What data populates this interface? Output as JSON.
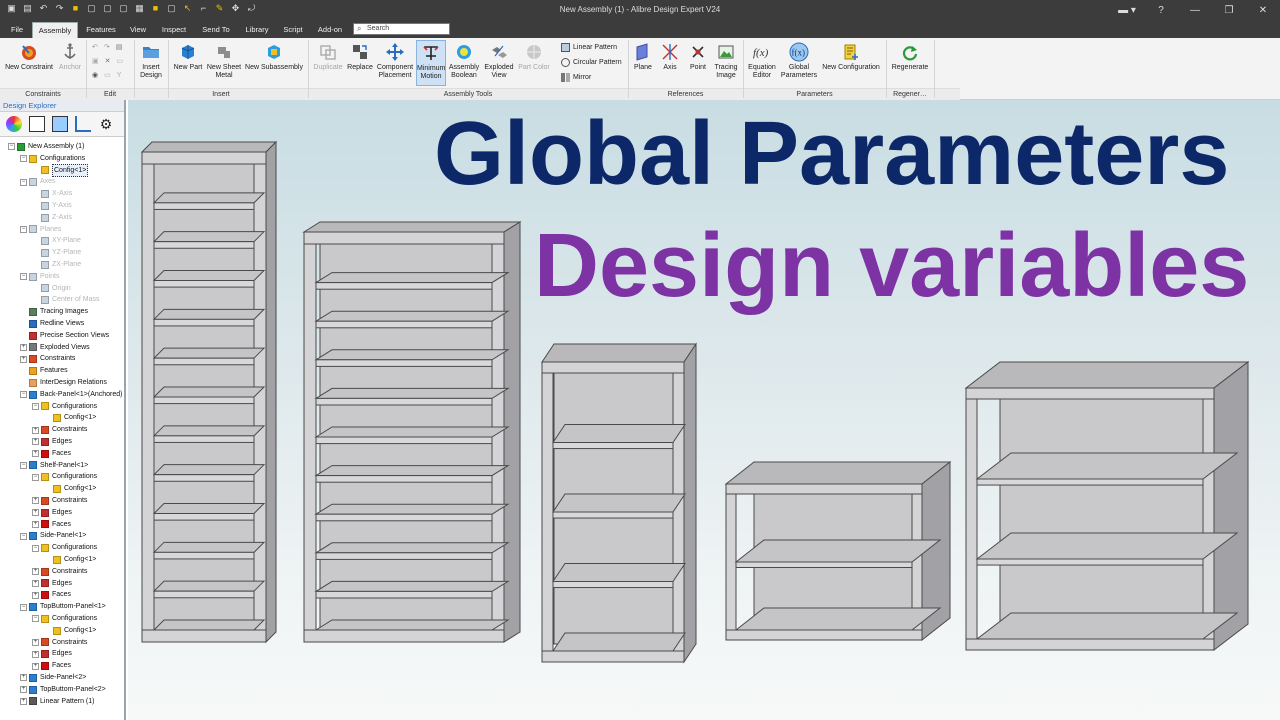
{
  "window": {
    "title": "New Assembly (1) - Alibre Design Expert V24"
  },
  "menu_tabs": [
    {
      "label": "File",
      "active": false
    },
    {
      "label": "Assembly",
      "active": true
    },
    {
      "label": "Features",
      "active": false
    },
    {
      "label": "View",
      "active": false
    },
    {
      "label": "Inspect",
      "active": false
    },
    {
      "label": "Send To",
      "active": false
    },
    {
      "label": "Library",
      "active": false
    },
    {
      "label": "Script",
      "active": false
    },
    {
      "label": "Add-on",
      "active": false
    }
  ],
  "search": {
    "placeholder": "Search"
  },
  "ribbon": {
    "groups": {
      "constraints": "Constraints",
      "edit": "Edit",
      "insert": "Insert",
      "assembly_tools": "Assembly Tools",
      "references": "References",
      "parameters": "Parameters",
      "regenerate": "Regener…"
    },
    "buttons": {
      "new_constraint": "New Constraint",
      "anchor": "Anchor",
      "insert_design": "Insert Design",
      "new_part": "New Part",
      "new_sheet_metal": "New Sheet Metal",
      "new_subassembly": "New Subassembly",
      "duplicate": "Duplicate",
      "replace": "Replace",
      "component_placement": "Component Placement",
      "minimum_motion": "Minimum Motion",
      "assembly_boolean": "Assembly Boolean",
      "exploded_view": "Exploded View",
      "part_color": "Part Color",
      "linear_pattern": "Linear Pattern",
      "circular_pattern": "Circular Pattern",
      "mirror": "Mirror",
      "plane": "Plane",
      "axis": "Axis",
      "point": "Point",
      "tracing_image": "Tracing Image",
      "equation_editor": "Equation Editor",
      "global_parameters": "Global Parameters",
      "new_configuration": "New Configuration",
      "regenerate": "Regenerate"
    }
  },
  "explorer": {
    "title": "Design Explorer",
    "tree": [
      {
        "label": "New Assembly (1)",
        "level": 0,
        "dim": false
      },
      {
        "label": "Configurations",
        "level": 1,
        "dim": false
      },
      {
        "label": "Config<1>",
        "level": 2,
        "dim": false,
        "selected": true
      },
      {
        "label": "Axes",
        "level": 1,
        "dim": true
      },
      {
        "label": "X-Axis",
        "level": 2,
        "dim": true
      },
      {
        "label": "Y-Axis",
        "level": 2,
        "dim": true
      },
      {
        "label": "Z-Axis",
        "level": 2,
        "dim": true
      },
      {
        "label": "Planes",
        "level": 1,
        "dim": true
      },
      {
        "label": "XY-Plane",
        "level": 2,
        "dim": true
      },
      {
        "label": "YZ-Plane",
        "level": 2,
        "dim": true
      },
      {
        "label": "ZX-Plane",
        "level": 2,
        "dim": true
      },
      {
        "label": "Points",
        "level": 1,
        "dim": true
      },
      {
        "label": "Origin",
        "level": 2,
        "dim": true
      },
      {
        "label": "Center of Mass",
        "level": 2,
        "dim": true
      },
      {
        "label": "Tracing Images",
        "level": 1,
        "dim": false
      },
      {
        "label": "Redline Views",
        "level": 1,
        "dim": false
      },
      {
        "label": "Precise Section Views",
        "level": 1,
        "dim": false
      },
      {
        "label": "Exploded Views",
        "level": 1,
        "dim": false
      },
      {
        "label": "Constraints",
        "level": 1,
        "dim": false
      },
      {
        "label": "Features",
        "level": 1,
        "dim": false
      },
      {
        "label": "InterDesign Relations",
        "level": 1,
        "dim": false
      },
      {
        "label": "Back-Panel<1>(Anchored)",
        "level": 1,
        "dim": false
      },
      {
        "label": "Configurations",
        "level": 2,
        "dim": false
      },
      {
        "label": "Config<1>",
        "level": 3,
        "dim": false
      },
      {
        "label": "Constraints",
        "level": 2,
        "dim": false
      },
      {
        "label": "Edges",
        "level": 2,
        "dim": false
      },
      {
        "label": "Faces",
        "level": 2,
        "dim": false
      },
      {
        "label": "Shelf-Panel<1>",
        "level": 1,
        "dim": false
      },
      {
        "label": "Configurations",
        "level": 2,
        "dim": false
      },
      {
        "label": "Config<1>",
        "level": 3,
        "dim": false
      },
      {
        "label": "Constraints",
        "level": 2,
        "dim": false
      },
      {
        "label": "Edges",
        "level": 2,
        "dim": false
      },
      {
        "label": "Faces",
        "level": 2,
        "dim": false
      },
      {
        "label": "Side-Panel<1>",
        "level": 1,
        "dim": false
      },
      {
        "label": "Configurations",
        "level": 2,
        "dim": false
      },
      {
        "label": "Config<1>",
        "level": 3,
        "dim": false
      },
      {
        "label": "Constraints",
        "level": 2,
        "dim": false
      },
      {
        "label": "Edges",
        "level": 2,
        "dim": false
      },
      {
        "label": "Faces",
        "level": 2,
        "dim": false
      },
      {
        "label": "TopButtom-Panel<1>",
        "level": 1,
        "dim": false
      },
      {
        "label": "Configurations",
        "level": 2,
        "dim": false
      },
      {
        "label": "Config<1>",
        "level": 3,
        "dim": false
      },
      {
        "label": "Constraints",
        "level": 2,
        "dim": false
      },
      {
        "label": "Edges",
        "level": 2,
        "dim": false
      },
      {
        "label": "Faces",
        "level": 2,
        "dim": false
      },
      {
        "label": "Side-Panel<2>",
        "level": 1,
        "dim": false
      },
      {
        "label": "TopButtom-Panel<2>",
        "level": 1,
        "dim": false
      },
      {
        "label": "Linear Pattern (1)",
        "level": 1,
        "dim": false
      }
    ]
  },
  "viewport": {
    "headline": "Global Parameters",
    "subheadline": "Design variables",
    "colors": {
      "headline": "#0c2868",
      "subheadline": "#7d33a4"
    }
  },
  "bookcases": [
    {
      "shelves": 11
    },
    {
      "shelves": 9
    },
    {
      "shelves": 3
    },
    {
      "shelves": 1
    },
    {
      "shelves": 2
    }
  ]
}
